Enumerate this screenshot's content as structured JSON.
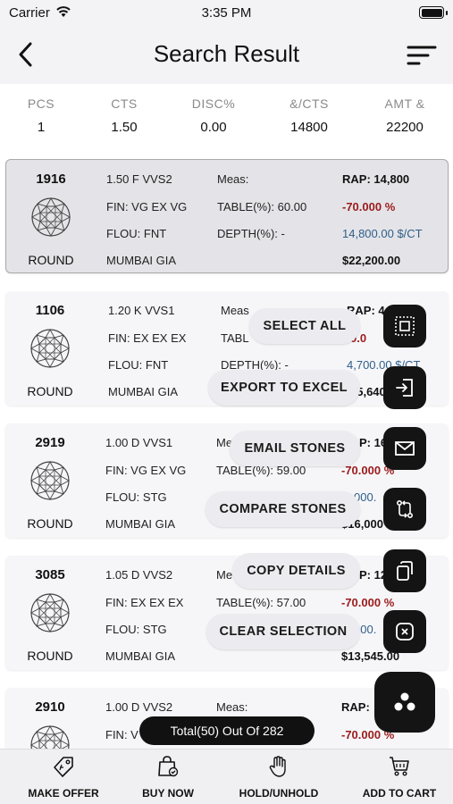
{
  "status": {
    "carrier": "Carrier",
    "time": "3:35 PM"
  },
  "nav": {
    "title": "Search Result",
    "back_icon": "chevron-left-icon",
    "sort_icon": "sort-lines-icon"
  },
  "summary": [
    {
      "label": "PCS",
      "value": "1"
    },
    {
      "label": "CTS",
      "value": "1.50"
    },
    {
      "label": "DISC%",
      "value": "0.00"
    },
    {
      "label": "&/CTS",
      "value": "14800"
    },
    {
      "label": "AMT &",
      "value": "22200"
    }
  ],
  "cards": [
    {
      "id": "1916",
      "shape": "ROUND",
      "spec": "1.50  F  VVS2",
      "fin": "FIN: VG EX VG",
      "flou": "FLOU: FNT",
      "loc": "MUMBAI  GIA",
      "meas": "Meas:",
      "table": "TABLE(%): 60.00",
      "depth": "DEPTH(%): -",
      "rap": "RAP: 14,800",
      "disc": "-70.000 %",
      "per_ct": "14,800.00 $/CT",
      "amount": "$22,200.00",
      "selected": true
    },
    {
      "id": "1106",
      "shape": "ROUND",
      "spec": "1.20  K  VVS1",
      "fin": "FIN: EX EX EX",
      "flou": "FLOU: FNT",
      "loc": "MUMBAI  GIA",
      "meas": "Meas",
      "table": "TABL",
      "depth": "DEPTH(%): -",
      "rap": "RAP: 4",
      "disc": "0.0",
      "per_ct": "4,700.00 $/CT",
      "amount": "$5,640",
      "selected": false
    },
    {
      "id": "2919",
      "shape": "ROUND",
      "spec": "1.00  D  VVS1",
      "fin": "FIN: VG EX VG",
      "flou": "FLOU: STG",
      "loc": "MUMBAI  GIA",
      "meas": "Me",
      "table": "TABLE(%): 59.00",
      "depth": "",
      "rap": "P: 16",
      "disc": "-70.000 %",
      "per_ct": "000.",
      "amount": "$16,000",
      "selected": false
    },
    {
      "id": "3085",
      "shape": "ROUND",
      "spec": "1.05  D  VVS2",
      "fin": "FIN: EX EX EX",
      "flou": "FLOU: STG",
      "loc": "MUMBAI  GIA",
      "meas": "Me",
      "table": "TABLE(%): 57.00",
      "depth": "",
      "rap": "P: 12",
      "disc": "-70.000 %",
      "per_ct": "900.",
      "amount": "$13,545.00",
      "selected": false
    },
    {
      "id": "2910",
      "shape": "ROUND",
      "spec": "1.00  D  VVS2",
      "fin": "FIN: V",
      "flou": "",
      "loc": "",
      "meas": "Meas:",
      "table": "",
      "depth": "",
      "rap": "RAP: ",
      "disc": "-70.000 %",
      "per_ct": "",
      "amount": "",
      "selected": false
    }
  ],
  "fab_menu": {
    "select_all": "SELECT ALL",
    "export_excel": "EXPORT TO EXCEL",
    "email_stones": "EMAIL STONES",
    "compare_stones": "COMPARE STONES",
    "copy_details": "COPY DETAILS",
    "clear_selection": "CLEAR SELECTION"
  },
  "total": "Total(50) Out Of 282",
  "tabs": [
    {
      "label": "MAKE OFFER",
      "icon": "price-tag-icon"
    },
    {
      "label": "BUY NOW",
      "icon": "shopping-bag-check-icon"
    },
    {
      "label": "HOLD/UNHOLD",
      "icon": "hand-icon"
    },
    {
      "label": "ADD TO CART",
      "icon": "cart-icon"
    }
  ],
  "colors": {
    "discount": "#9b1b1b",
    "per_ct": "#2f5f8a",
    "fab_dark": "#141414"
  }
}
